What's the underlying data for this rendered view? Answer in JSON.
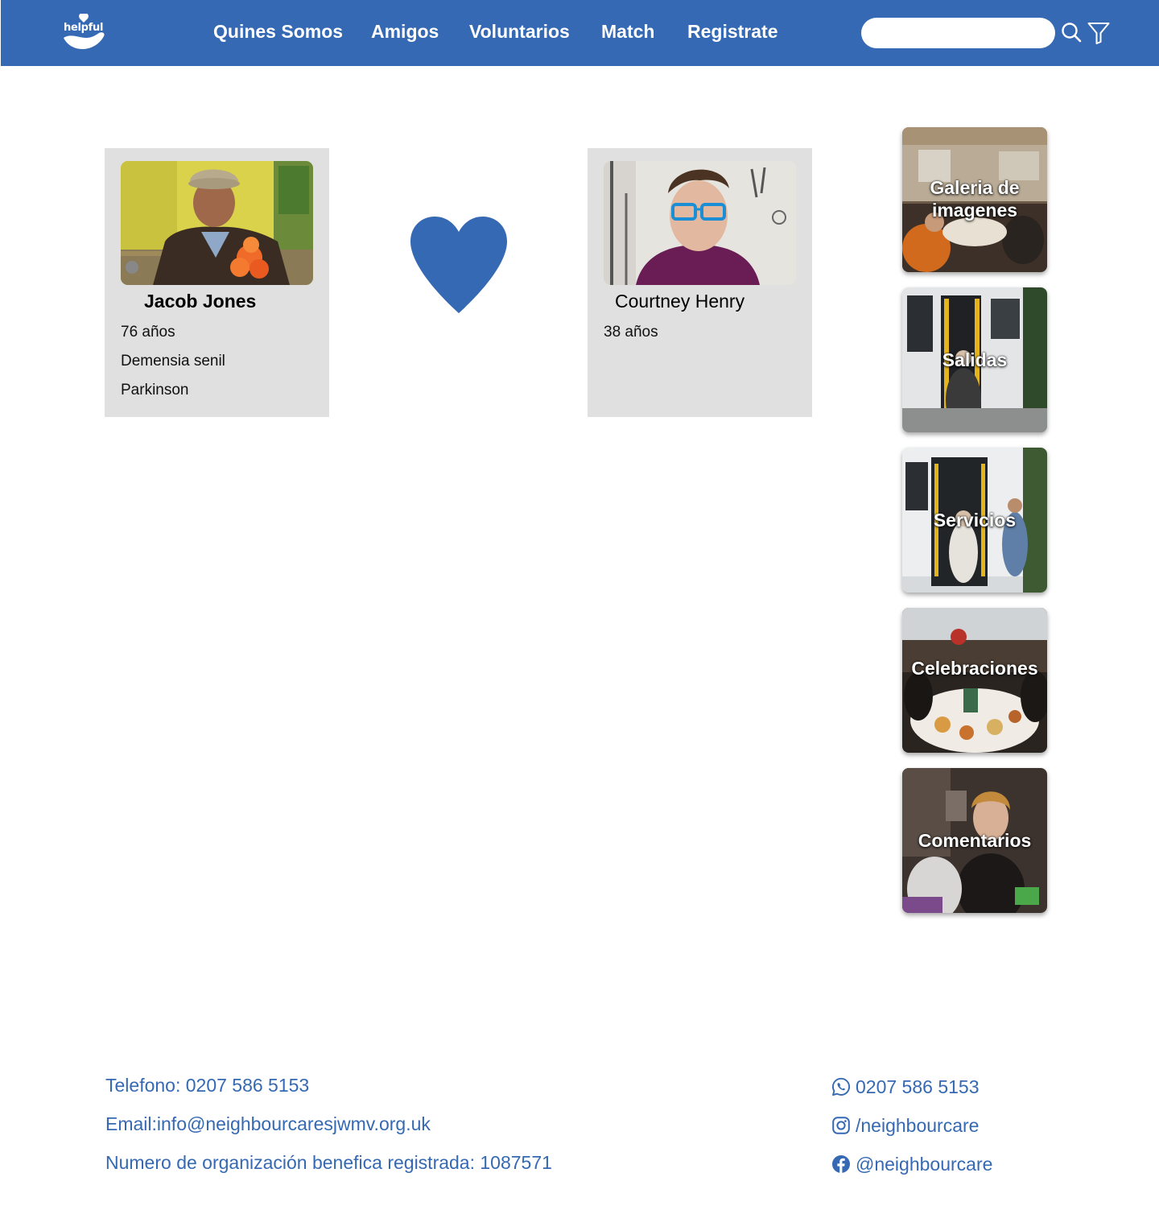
{
  "header": {
    "logo_text": "helpful",
    "nav": [
      {
        "label": "Quines Somos"
      },
      {
        "label": "Amigos"
      },
      {
        "label": "Voluntarios"
      },
      {
        "label": "Match"
      },
      {
        "label": "Registrate"
      }
    ],
    "search": {
      "value": "",
      "placeholder": ""
    }
  },
  "match": {
    "senior": {
      "name": "Jacob Jones",
      "age": "76 años",
      "conditions": [
        "Demensia senil",
        "Parkinson"
      ]
    },
    "volunteer": {
      "name": "Courtney Henry",
      "age": "38 años"
    }
  },
  "sidebar": {
    "tiles": [
      {
        "label": "Galeria de imagenes"
      },
      {
        "label": "Salidas"
      },
      {
        "label": "Servicios"
      },
      {
        "label": "Celebraciones"
      },
      {
        "label": "Comentarios"
      }
    ]
  },
  "footer": {
    "phone": "Telefono: 0207 586 5153",
    "email": "Email:info@neighbourcaresjwmv.org.uk",
    "charity": "Numero de organización benefica registrada: 1087571",
    "whatsapp": "0207 586 5153",
    "instagram": "/neighbourcare",
    "facebook": "@neighbourcare"
  },
  "colors": {
    "brand": "#3569b3",
    "card_bg": "#e0e0e0"
  }
}
